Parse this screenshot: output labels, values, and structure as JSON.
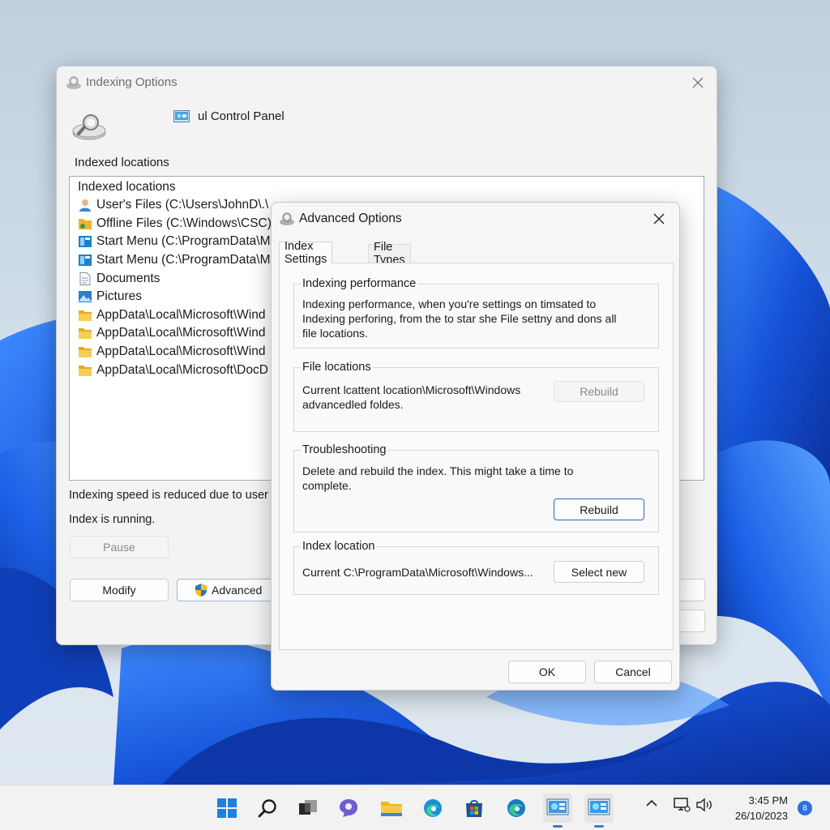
{
  "indexing_window": {
    "title": "Indexing Options",
    "control_panel_label": "ul Control Panel",
    "locations_heading": "Indexed locations",
    "list": {
      "header": "Indexed locations",
      "items": [
        {
          "icon": "user-icon",
          "text": "User's Files (C:\\Users\\JohnD\\.\\"
        },
        {
          "icon": "folder-sync-icon",
          "text": "Offline Files (C:\\Windows\\CSC)"
        },
        {
          "icon": "start-menu-icon",
          "text": "Start Menu (C:\\ProgramData\\M"
        },
        {
          "icon": "start-menu-icon",
          "text": "Start Menu  (C:\\ProgramData\\M"
        },
        {
          "icon": "document-icon",
          "text": "Documents"
        },
        {
          "icon": "pictures-icon",
          "text": "Pictures"
        },
        {
          "icon": "folder-icon",
          "text": "AppData\\Local\\Microsoft\\Wind"
        },
        {
          "icon": "folder-icon",
          "text": "AppData\\Local\\Microsoft\\Wind"
        },
        {
          "icon": "folder-icon",
          "text": "AppData\\Local\\Microsoft\\Wind"
        },
        {
          "icon": "folder-icon",
          "text": "AppData\\Local\\Microsoft\\DocD"
        }
      ]
    },
    "status_speed": "Indexing speed is reduced due to user",
    "status_running": "Index is running.",
    "pause_label": "Pause",
    "modify_label": "Modify",
    "advanced_label": "Advanced"
  },
  "advanced_dialog": {
    "title": "Advanced Options",
    "tabs": [
      {
        "label": "Index Settings",
        "active": true
      },
      {
        "label": "File Types",
        "active": false
      }
    ],
    "groups": {
      "performance": {
        "label": "Indexing performance",
        "text_lines": [
          "Indexing performance, when you're settings on timsated to",
          "Indexing perforing, from the to star she File settny and dons all",
          "file locations."
        ]
      },
      "file_locations": {
        "label": "File locations",
        "text_lines": [
          "Current lcattent location\\Microsoft\\Windows",
          "advancedled foldes."
        ],
        "rebuild_label": "Rebuild"
      },
      "troubleshooting": {
        "label": "Troubleshooting",
        "text_lines": [
          "Delete and rebuild the index. This might take a time to",
          "complete."
        ],
        "rebuild_label": "Rebuild"
      },
      "index_location": {
        "label": "Index location",
        "current": "Current C:\\ProgramData\\Microsoft\\Windows...",
        "select_new_label": "Select new"
      }
    },
    "ok_label": "OK",
    "cancel_label": "Cancel"
  },
  "taskbar": {
    "icons": [
      "windows-start-icon",
      "search-icon",
      "task-view-icon",
      "chat-icon",
      "file-explorer-icon",
      "edge-icon",
      "store-icon",
      "edge-icon",
      "control-panel-icon",
      "control-panel-icon"
    ],
    "time": "3:45 PM",
    "date": "26/10/2023",
    "notification_count": "8"
  },
  "colors": {
    "accent": "#2a68b8",
    "wallpaper_blue": "#1f5fd6"
  }
}
